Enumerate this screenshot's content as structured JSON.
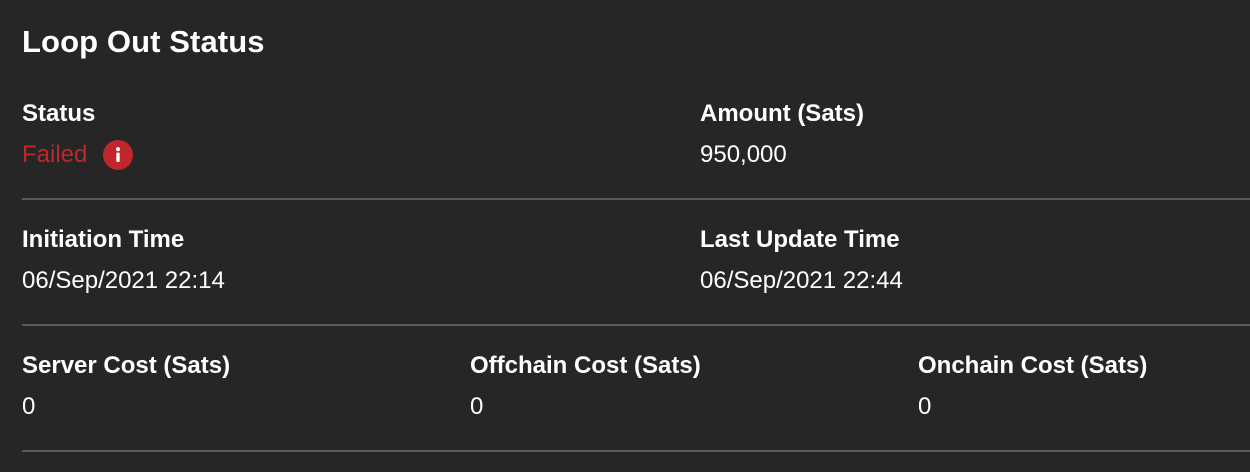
{
  "panel": {
    "title": "Loop Out Status"
  },
  "status": {
    "label": "Status",
    "value": "Failed",
    "value_color": "#c0272d",
    "icon": "info-icon"
  },
  "amount": {
    "label": "Amount (Sats)",
    "value": "950,000"
  },
  "initiation_time": {
    "label": "Initiation Time",
    "value": "06/Sep/2021 22:14"
  },
  "last_update_time": {
    "label": "Last Update Time",
    "value": "06/Sep/2021 22:44"
  },
  "server_cost": {
    "label": "Server Cost (Sats)",
    "value": "0"
  },
  "offchain_cost": {
    "label": "Offchain Cost (Sats)",
    "value": "0"
  },
  "onchain_cost": {
    "label": "Onchain Cost (Sats)",
    "value": "0"
  },
  "colors": {
    "background": "#262626",
    "text": "#ffffff",
    "error": "#c0272d",
    "divider": "#5a5a5a"
  }
}
